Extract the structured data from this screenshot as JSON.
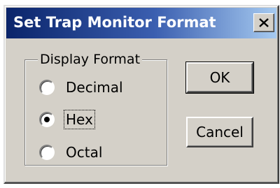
{
  "dialog": {
    "title": "Set Trap Monitor Format",
    "close_label": "X"
  },
  "display_format": {
    "label": "Display Format",
    "options": [
      {
        "label": "Decimal",
        "selected": false
      },
      {
        "label": "Hex",
        "selected": true
      },
      {
        "label": "Octal",
        "selected": false
      }
    ]
  },
  "buttons": {
    "ok_label": "OK",
    "cancel_label": "Cancel"
  }
}
